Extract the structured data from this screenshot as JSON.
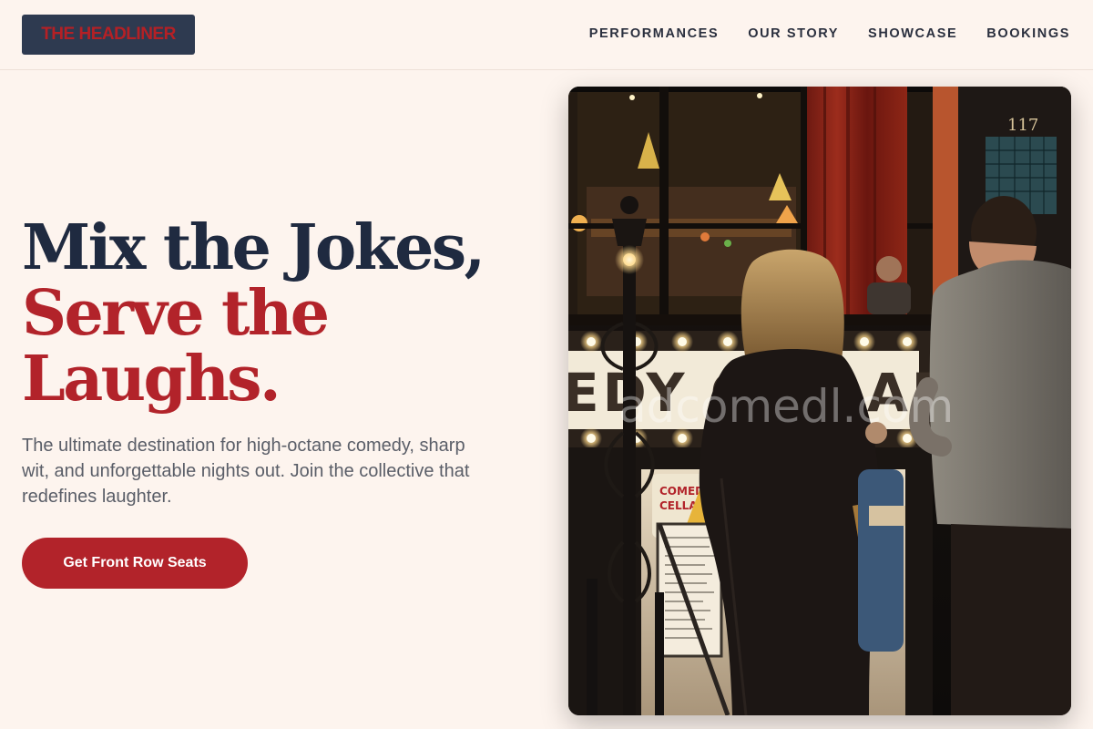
{
  "brand": {
    "name": "THE HEADLINER"
  },
  "nav": {
    "items": [
      {
        "label": "PERFORMANCES"
      },
      {
        "label": "OUR STORY"
      },
      {
        "label": "SHOWCASE"
      },
      {
        "label": "BOOKINGS"
      }
    ]
  },
  "hero": {
    "title_line1": "Mix the Jokes,",
    "title_line2": "Serve the",
    "title_line3": "Laughs.",
    "subtitle": "The ultimate destination for high-octane comedy, sharp wit, and unforgettable nights out. Join the collective that redefines laughter.",
    "cta_label": "Get Front Row Seats"
  },
  "photo": {
    "marquee_text": "EDY CELLAR",
    "door_number": "117",
    "sign_text_1": "COMEDY",
    "sign_text_2": "CELLAR",
    "watermark": "adcomedl.com"
  },
  "colors": {
    "background": "#fdf4ee",
    "navy": "#1f2a40",
    "accent_red": "#b2232a",
    "logo_bg": "#2e3a50"
  }
}
